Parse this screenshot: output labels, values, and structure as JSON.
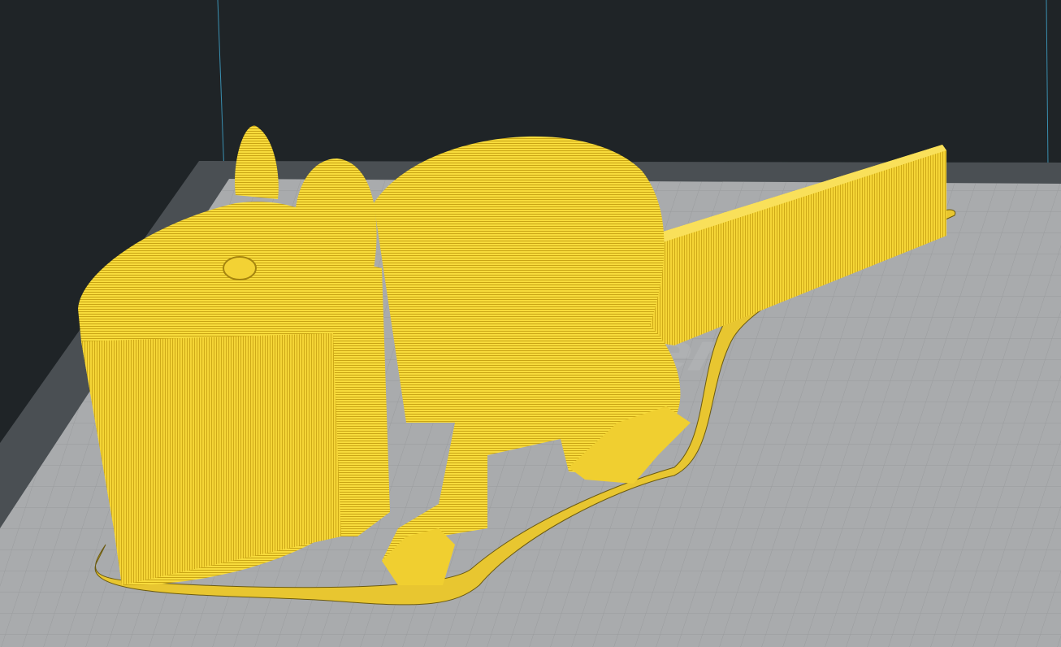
{
  "scene": {
    "watermark_text": "er",
    "colors": {
      "background": "#1f2427",
      "bed_border": "#4a4f53",
      "bed": "#a9abad",
      "grid": "#9a9c9e",
      "model": "#f7d73a",
      "model_shadow": "#d9b51c",
      "axis_line": "#3a8fb0"
    },
    "model_icon": "rat-model"
  }
}
